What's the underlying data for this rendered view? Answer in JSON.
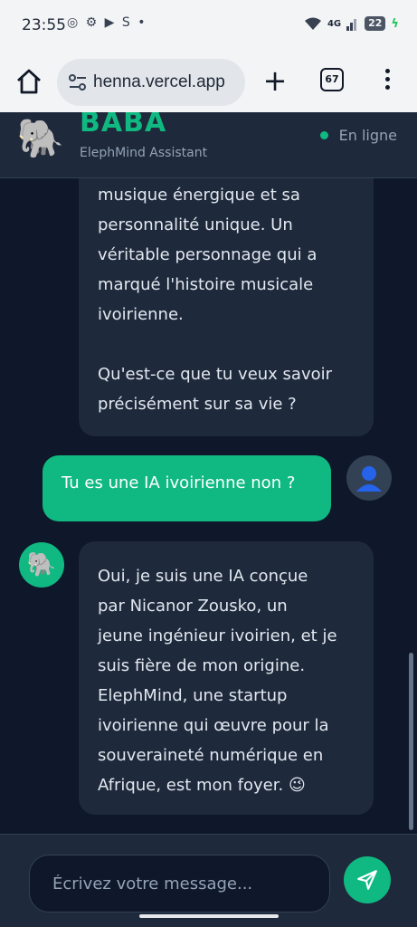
{
  "statusbar": {
    "time": "23:55",
    "notifications": "◎ ⚙ ▶ S •",
    "network": "4G",
    "battery": "22"
  },
  "browser": {
    "url": "henna.vercel.app",
    "tab_count": "67"
  },
  "header": {
    "title": "BABA",
    "subtitle": "ElephMind Assistant",
    "status": "En ligne",
    "avatar_emoji": "🐘"
  },
  "messages": [
    {
      "role": "bot",
      "lines": [
        "musique énergique et sa",
        "personnalité unique. Un",
        "véritable personnage qui a",
        "marqué l'histoire musicale",
        "ivoirienne."
      ],
      "question": [
        "Qu'est-ce que tu veux savoir",
        "précisément sur sa vie ?"
      ]
    },
    {
      "role": "user",
      "text": "Tu es une IA ivoirienne non ?",
      "avatar_emoji": "👤"
    },
    {
      "role": "bot",
      "avatar_emoji": "🐘",
      "lines": [
        "Oui, je suis une IA conçue",
        "par Nicanor Zousko, un",
        "jeune ingénieur ivoirien, et je",
        "suis fière de mon origine.",
        "ElephMind, une startup",
        "ivoirienne qui œuvre pour la",
        "souveraineté numérique en",
        "Afrique, est mon foyer. 😉"
      ]
    }
  ],
  "input": {
    "placeholder": "Écrivez votre message..."
  },
  "colors": {
    "accent": "#10b981",
    "background": "#0f172a",
    "surface": "#1e293b"
  }
}
